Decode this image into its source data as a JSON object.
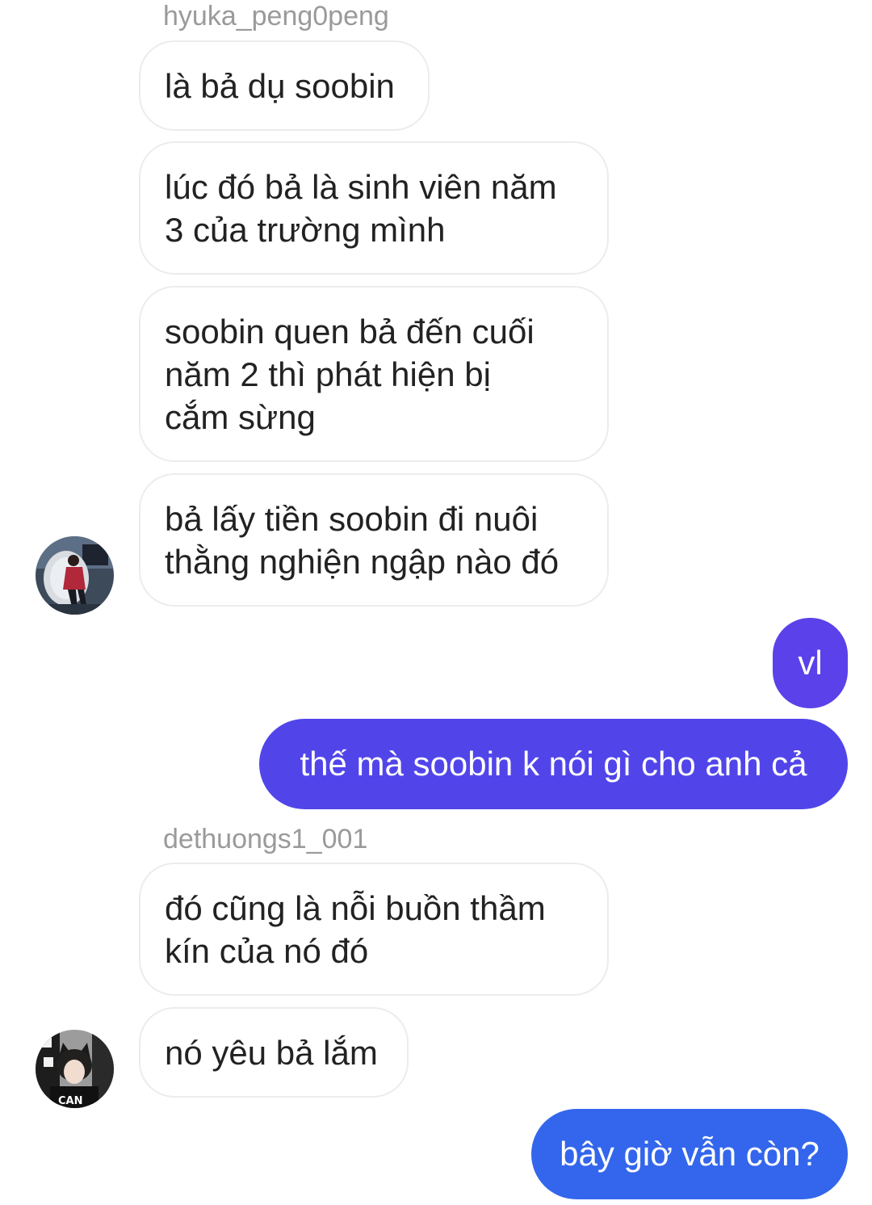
{
  "thread": {
    "senders": {
      "first": "hyuka_peng0peng",
      "second": "dethuongs1_001"
    },
    "incoming_group_1": [
      {
        "lines": [
          "là bả dụ soobin"
        ]
      },
      {
        "lines": [
          "lúc đó bả là sinh viên năm",
          "3 của trường mình"
        ]
      },
      {
        "lines": [
          "soobin quen bả đến cuối",
          "năm 2 thì phát hiện bị",
          "cắm sừng"
        ]
      },
      {
        "lines": [
          "bả lấy tiền soobin đi nuôi",
          "thằng nghiện ngập nào đó"
        ]
      }
    ],
    "outgoing_group_1": [
      {
        "text": "vl"
      },
      {
        "text": "thế mà soobin k nói gì cho anh cả"
      }
    ],
    "incoming_group_2": [
      {
        "lines": [
          "đó cũng là nỗi buồn thầm",
          "kín của nó đó"
        ]
      },
      {
        "lines": [
          "nó yêu bả lắm"
        ]
      }
    ],
    "outgoing_group_2": [
      {
        "text": "bây giờ vẫn còn?"
      }
    ]
  },
  "colors": {
    "outgoing_violet": "#5a41e9",
    "outgoing_indigo": "#5145ea",
    "outgoing_blue": "#3366ec",
    "incoming_bg": "#ffffff",
    "incoming_border": "#ececec",
    "sender_text": "#9a9a9a"
  },
  "icons": {
    "avatar_1": "profile-photo-person-red-jacket",
    "avatar_2": "profile-photo-girl-cat-ears"
  }
}
